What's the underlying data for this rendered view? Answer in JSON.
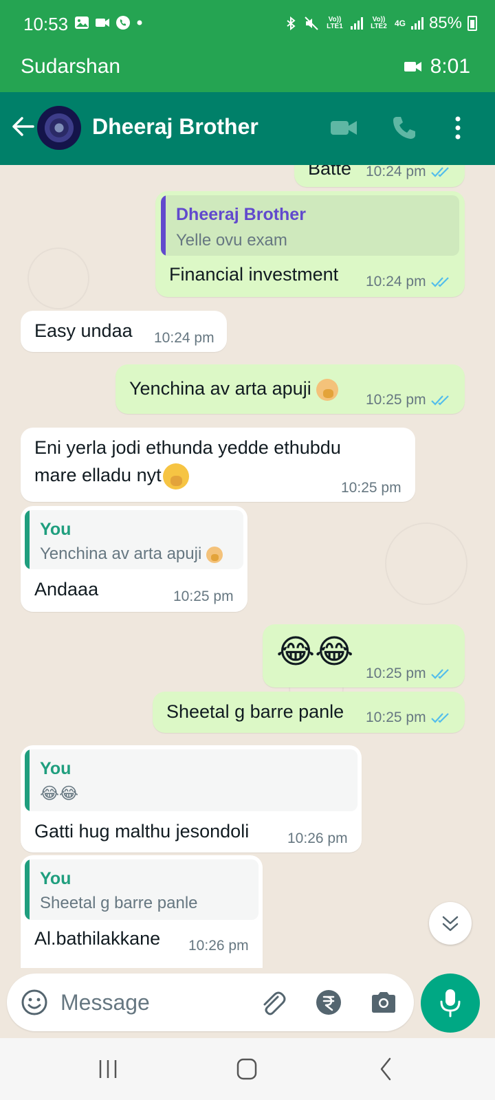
{
  "status_bar": {
    "time": "10:53",
    "left_icons": [
      "gallery-icon",
      "video-icon",
      "whatsapp-icon",
      "dot"
    ],
    "right_icons": [
      "bluetooth-icon",
      "mute-icon"
    ],
    "sim1": "Vo)) LTE1",
    "sim2": "Vo)) LTE2",
    "network": "4G",
    "battery": "85%"
  },
  "call_banner": {
    "caller": "Sudarshan",
    "duration": "8:01"
  },
  "header": {
    "contact_name": "Dheeraj Brother"
  },
  "messages": [
    {
      "dir": "out",
      "text": "Batte",
      "time": "10:24 pm",
      "ticks": "read"
    },
    {
      "dir": "out",
      "quote_author": "Dheeraj Brother",
      "quote_text": "Yelle ovu exam",
      "text": "Financial investment",
      "time": "10:24 pm",
      "ticks": "read"
    },
    {
      "dir": "in",
      "text": "Easy undaa",
      "time": "10:24 pm"
    },
    {
      "dir": "out",
      "text": "Yenchina av arta apuji",
      "time": "10:25 pm",
      "ticks": "read"
    },
    {
      "dir": "in",
      "text_line1": "Eni yerla jodi ethunda yedde ethubdu",
      "text_line2": "mare elladu nyt",
      "time": "10:25 pm"
    },
    {
      "dir": "in",
      "quote_author": "You",
      "quote_text": "Yenchina av arta apuji",
      "text": "Andaaa",
      "time": "10:25 pm"
    },
    {
      "dir": "out",
      "text": "😂😂",
      "time": "10:25 pm",
      "ticks": "read"
    },
    {
      "dir": "out",
      "text": "Sheetal g barre panle",
      "time": "10:25 pm",
      "ticks": "read"
    },
    {
      "dir": "in",
      "quote_author": "You",
      "quote_text": "😂😂",
      "text": "Gatti hug malthu jesondoli",
      "time": "10:26 pm"
    },
    {
      "dir": "in",
      "quote_author": "You",
      "quote_text": "Sheetal g barre panle",
      "text": "Al.bathilakkane",
      "time": "10:26 pm"
    }
  ],
  "composer": {
    "placeholder": "Message"
  },
  "colors": {
    "header": "#008069",
    "status": "#25a452",
    "outgoing": "#dcf8c6",
    "accent": "#00a884",
    "quote_author_contact": "#6149cd",
    "quote_author_you": "#1f9e7e"
  }
}
